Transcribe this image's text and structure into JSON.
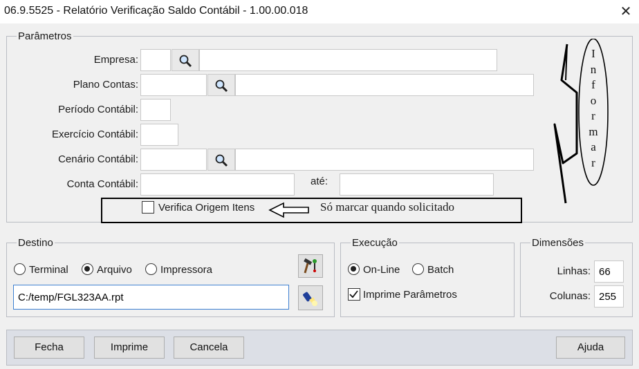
{
  "window": {
    "title": "06.9.5525 - Relatório Verificação Saldo Contábil - 1.00.00.018",
    "close_icon": "close-icon"
  },
  "parametros": {
    "legend": "Parâmetros",
    "empresa_label": "Empresa:",
    "plano_contas_label": "Plano Contas:",
    "periodo_label": "Período Contábil:",
    "exercicio_label": "Exercício Contábil:",
    "cenario_label": "Cenário Contábil:",
    "conta_label": "Conta Contábil:",
    "ate_label": "até:",
    "verifica_origem_label": "Verifica Origem Itens",
    "lookup_icon": "magnifier-icon"
  },
  "annotation": {
    "note_text": "Só marcar quando solicitado",
    "informar_letters": [
      "I",
      "n",
      "f",
      "o",
      "r",
      "m",
      "a",
      "r"
    ]
  },
  "destino": {
    "legend": "Destino",
    "options": [
      "Terminal",
      "Arquivo",
      "Impressora"
    ],
    "selected": "Arquivo",
    "file_path": "C:/temp/FGL323AA.rpt"
  },
  "execucao": {
    "legend": "Execução",
    "options": [
      "On-Line",
      "Batch"
    ],
    "selected": "On-Line",
    "imprime_parametros_label": "Imprime Parâmetros",
    "imprime_parametros_checked": true
  },
  "dimensoes": {
    "legend": "Dimensões",
    "linhas_label": "Linhas:",
    "linhas_value": "66",
    "colunas_label": "Colunas:",
    "colunas_value": "255"
  },
  "footer": {
    "fecha_label": "Fecha",
    "imprime_label": "Imprime",
    "cancela_label": "Cancela",
    "ajuda_label": "Ajuda"
  }
}
